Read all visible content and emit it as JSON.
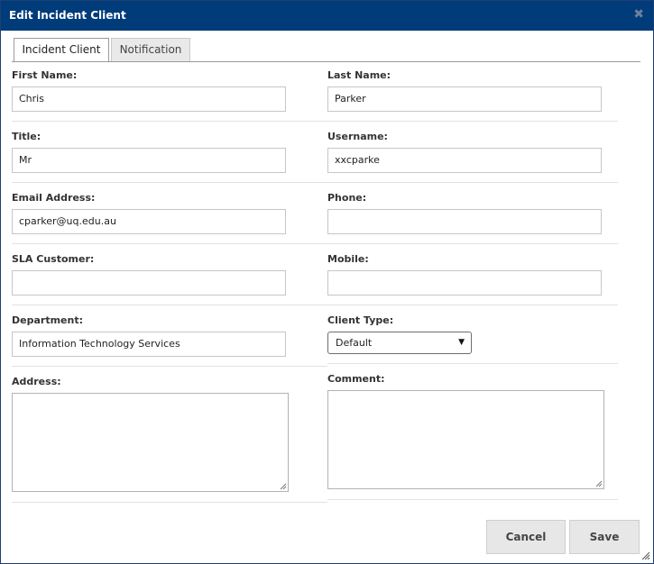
{
  "dialog": {
    "title": "Edit Incident Client",
    "close_symbol": "✖"
  },
  "tabs": [
    {
      "label": "Incident Client",
      "active": true
    },
    {
      "label": "Notification",
      "active": false
    }
  ],
  "fields": {
    "first_name": {
      "label": "First Name:",
      "value": "Chris"
    },
    "last_name": {
      "label": "Last Name:",
      "value": "Parker"
    },
    "title": {
      "label": "Title:",
      "value": "Mr"
    },
    "username": {
      "label": "Username:",
      "value": "xxcparke"
    },
    "email": {
      "label": "Email Address:",
      "value": "cparker@uq.edu.au"
    },
    "phone": {
      "label": "Phone:",
      "value": ""
    },
    "sla_customer": {
      "label": "SLA Customer:",
      "value": ""
    },
    "mobile": {
      "label": "Mobile:",
      "value": ""
    },
    "department": {
      "label": "Department:",
      "value": "Information Technology Services"
    },
    "client_type": {
      "label": "Client Type:",
      "selected": "Default"
    },
    "address": {
      "label": "Address:",
      "value": ""
    },
    "comment": {
      "label": "Comment:",
      "value": ""
    }
  },
  "buttons": {
    "cancel": "Cancel",
    "save": "Save"
  },
  "colors": {
    "titlebar": "#003b7a",
    "button_bg": "#e7e7e7"
  }
}
